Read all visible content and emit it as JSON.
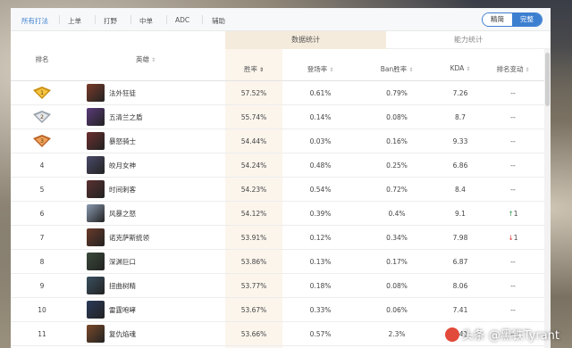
{
  "filters": {
    "tabs": [
      "所有打法",
      "上单",
      "打野",
      "中单",
      "ADC",
      "辅助"
    ],
    "active_tab": 0
  },
  "view_toggle": {
    "simple": "精简",
    "full": "完整",
    "selected": "完整"
  },
  "groups": {
    "data_stats": "数据统计",
    "ability_stats": "能力统计",
    "active": "数据统计"
  },
  "columns": {
    "rank": "排名",
    "hero": "英雄",
    "winrate": "胜率",
    "pickrate": "登场率",
    "banrate": "Ban胜率",
    "kda": "KDA",
    "rank_change": "排名变动"
  },
  "sort_glyph": "⇕",
  "sort_active_glyph": "⇕",
  "rows": [
    {
      "rank": "1",
      "medal": "gold",
      "hero": "法外狂徒",
      "winrate": "57.52%",
      "pickrate": "0.61%",
      "banrate": "0.79%",
      "kda": "7.26",
      "change": "--",
      "avatar_color": "#7a3b2a"
    },
    {
      "rank": "2",
      "medal": "silver",
      "hero": "五清兰之盾",
      "winrate": "55.74%",
      "pickrate": "0.14%",
      "banrate": "0.08%",
      "kda": "8.7",
      "change": "--",
      "avatar_color": "#5b3a7a"
    },
    {
      "rank": "3",
      "medal": "bronze",
      "hero": "暴怒骑士",
      "winrate": "54.44%",
      "pickrate": "0.03%",
      "banrate": "0.16%",
      "kda": "9.33",
      "change": "--",
      "avatar_color": "#6b2f2f"
    },
    {
      "rank": "4",
      "medal": "",
      "hero": "皎月女神",
      "winrate": "54.24%",
      "pickrate": "0.48%",
      "banrate": "0.25%",
      "kda": "6.86",
      "change": "--",
      "avatar_color": "#4a4a6a"
    },
    {
      "rank": "5",
      "medal": "",
      "hero": "时间刺客",
      "winrate": "54.23%",
      "pickrate": "0.54%",
      "banrate": "0.72%",
      "kda": "8.4",
      "change": "--",
      "avatar_color": "#5a3030"
    },
    {
      "rank": "6",
      "medal": "",
      "hero": "风暴之怒",
      "winrate": "54.12%",
      "pickrate": "0.39%",
      "banrate": "0.4%",
      "kda": "9.1",
      "change": "1",
      "trend": "up",
      "avatar_color": "#8a9ab0"
    },
    {
      "rank": "7",
      "medal": "",
      "hero": "诺克萨斯统领",
      "winrate": "53.91%",
      "pickrate": "0.12%",
      "banrate": "0.34%",
      "kda": "7.98",
      "change": "1",
      "trend": "down",
      "avatar_color": "#6a3a2a"
    },
    {
      "rank": "8",
      "medal": "",
      "hero": "深渊巨口",
      "winrate": "53.86%",
      "pickrate": "0.13%",
      "banrate": "0.17%",
      "kda": "6.87",
      "change": "--",
      "avatar_color": "#3a4a3a"
    },
    {
      "rank": "9",
      "medal": "",
      "hero": "扭曲树精",
      "winrate": "53.77%",
      "pickrate": "0.18%",
      "banrate": "0.08%",
      "kda": "8.06",
      "change": "--",
      "avatar_color": "#3a5060"
    },
    {
      "rank": "10",
      "medal": "",
      "hero": "雷霆咆哮",
      "winrate": "53.67%",
      "pickrate": "0.33%",
      "banrate": "0.06%",
      "kda": "7.41",
      "change": "--",
      "avatar_color": "#2a3a5a"
    },
    {
      "rank": "11",
      "medal": "",
      "hero": "复仇焰魂",
      "winrate": "53.66%",
      "pickrate": "0.57%",
      "banrate": "2.3%",
      "kda": "8.41",
      "change": "--",
      "avatar_color": "#7a4a2a"
    }
  ],
  "trend_up_glyph": "↑",
  "trend_down_glyph": "↓",
  "watermark": "头条 @黑铁Tyrant"
}
